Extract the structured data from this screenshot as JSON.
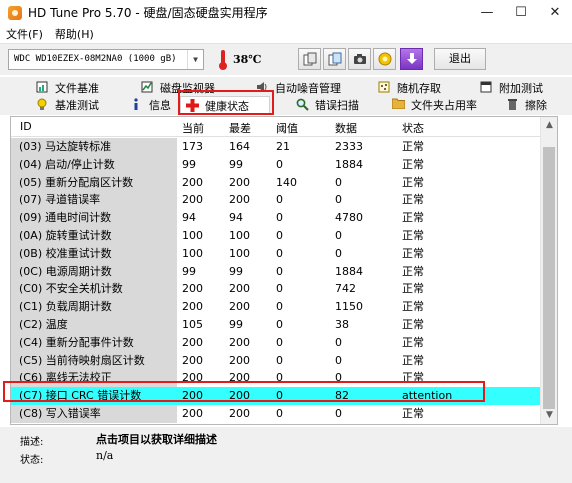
{
  "window": {
    "title": "HD Tune Pro 5.70 - 硬盘/固态硬盘实用程序"
  },
  "menu": {
    "file": "文件(F)",
    "help": "帮助(H)"
  },
  "toolbar": {
    "drive": "WDC WD10EZEX-08M2NA0 (1000 gB)",
    "temperature": "38℃",
    "exit_label": "退出"
  },
  "tabs": {
    "row1": [
      "文件基准",
      "磁盘监视器",
      "自动噪音管理",
      "随机存取",
      "附加测试"
    ],
    "row2": [
      "基准测试",
      "信息",
      "健康状态",
      "错误扫描",
      "文件夹占用率",
      "擦除"
    ],
    "active": "健康状态"
  },
  "table": {
    "headers": [
      "ID",
      "当前",
      "最差",
      "阈值",
      "数据",
      "状态"
    ],
    "rows": [
      [
        "(03) 马达旋转标准",
        "173",
        "164",
        "21",
        "2333",
        "正常"
      ],
      [
        "(04) 启动/停止计数",
        "99",
        "99",
        "0",
        "1884",
        "正常"
      ],
      [
        "(05) 重新分配扇区计数",
        "200",
        "200",
        "140",
        "0",
        "正常"
      ],
      [
        "(07) 寻道错误率",
        "200",
        "200",
        "0",
        "0",
        "正常"
      ],
      [
        "(09) 通电时间计数",
        "94",
        "94",
        "0",
        "4780",
        "正常"
      ],
      [
        "(0A) 旋转重试计数",
        "100",
        "100",
        "0",
        "0",
        "正常"
      ],
      [
        "(0B) 校准重试计数",
        "100",
        "100",
        "0",
        "0",
        "正常"
      ],
      [
        "(0C) 电源周期计数",
        "99",
        "99",
        "0",
        "1884",
        "正常"
      ],
      [
        "(C0) 不安全关机计数",
        "200",
        "200",
        "0",
        "742",
        "正常"
      ],
      [
        "(C1) 负载周期计数",
        "200",
        "200",
        "0",
        "1150",
        "正常"
      ],
      [
        "(C2) 温度",
        "105",
        "99",
        "0",
        "38",
        "正常"
      ],
      [
        "(C4) 重新分配事件计数",
        "200",
        "200",
        "0",
        "0",
        "正常"
      ],
      [
        "(C5) 当前待映射扇区计数",
        "200",
        "200",
        "0",
        "0",
        "正常"
      ],
      [
        "(C6) 离线无法校正",
        "200",
        "200",
        "0",
        "0",
        "正常"
      ],
      [
        "(C7) 接口 CRC 错误计数",
        "200",
        "200",
        "0",
        "82",
        "attention"
      ],
      [
        "(C8) 写入错误率",
        "200",
        "200",
        "0",
        "0",
        "正常"
      ]
    ],
    "selected_row": 14
  },
  "footer": {
    "desc_label": "描述:",
    "desc_value": "点击项目以获取详细描述",
    "status_label": "状态:",
    "status_value": "n/a"
  },
  "colors": {
    "selected_row": "#33ffff",
    "highlight_box": "#e21b1b",
    "id_column_bg": "#d9d9d9"
  }
}
